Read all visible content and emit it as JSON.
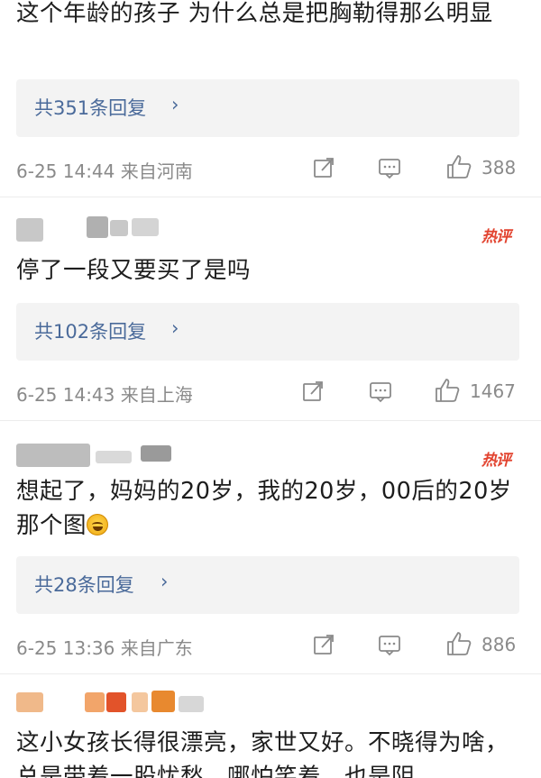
{
  "comments": [
    {
      "text": "这个年龄的孩子 为什么总是把胸勒得那么明显",
      "reply_label": "共351条回复",
      "time_location": "6-25 14:44 来自河南",
      "likes": "388"
    },
    {
      "hot_badge": "热评",
      "text": "停了一段又要买了是吗",
      "reply_label": "共102条回复",
      "time_location": "6-25 14:43 来自上海",
      "likes": "1467"
    },
    {
      "hot_badge": "热评",
      "text": "想起了，妈妈的20岁，我的20岁，00后的20岁那个图",
      "reply_label": "共28条回复",
      "time_location": "6-25 13:36 来自广东",
      "likes": "886"
    },
    {
      "text": "这小女孩长得很漂亮，家世又好。不晓得为啥，总是带着一股忧愁，哪怕笑着，也是阴"
    }
  ],
  "icons": {
    "share": "share-icon",
    "comment": "comment-icon",
    "like": "thumbs-up-icon",
    "reply_arrow": "chevron-right-icon"
  },
  "colors": {
    "hot_badge": "#e2432f",
    "reply_link": "#4a6a9a",
    "meta": "#8a8a8a",
    "reply_bg": "#f3f3f3"
  }
}
